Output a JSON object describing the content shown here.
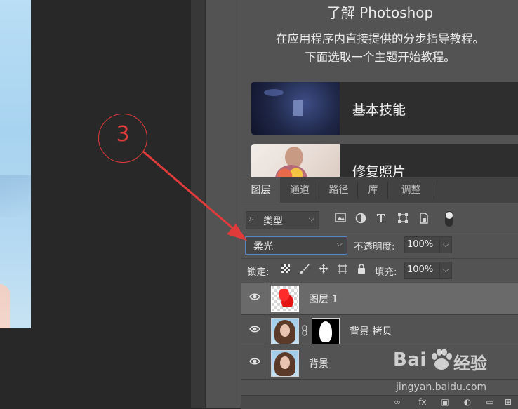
{
  "learn_panel": {
    "title": "了解 Photoshop",
    "description_line1": "在应用程序内直接提供的分步指导教程。",
    "description_line2": "下面选取一个主题开始教程。",
    "cards": [
      {
        "label": "基本技能"
      },
      {
        "label": "修复照片"
      }
    ]
  },
  "layers_panel": {
    "tabs": [
      {
        "label": "图层",
        "active": true
      },
      {
        "label": "通道",
        "active": false
      },
      {
        "label": "路径",
        "active": false
      },
      {
        "label": "库",
        "active": false
      },
      {
        "label": "调整",
        "active": false
      }
    ],
    "filter": {
      "kind_label": "类型",
      "icons": [
        "image-filter-icon",
        "adjustment-filter-icon",
        "type-filter-icon",
        "shape-filter-icon",
        "smart-object-filter-icon"
      ]
    },
    "blend_mode": "柔光",
    "opacity_label": "不透明度:",
    "opacity_value": "100%",
    "lock_label": "锁定:",
    "fill_label": "填充:",
    "fill_value": "100%",
    "layers": [
      {
        "name": "图层 1",
        "visible": true,
        "selected": true
      },
      {
        "name": "背景 拷贝",
        "visible": true,
        "selected": false,
        "has_mask": true
      },
      {
        "name": "背景",
        "visible": true,
        "selected": false
      }
    ]
  },
  "annotation": {
    "step_number": "3",
    "color": "#e03a3a"
  },
  "watermark": {
    "logo_left": "Bai",
    "logo_right": "经验",
    "url": "jingyan.baidu.com"
  },
  "colors": {
    "panel_bg": "#535353",
    "selected_layer_bg": "#6a6a6a",
    "blend_select_border": "#5b86c9"
  }
}
